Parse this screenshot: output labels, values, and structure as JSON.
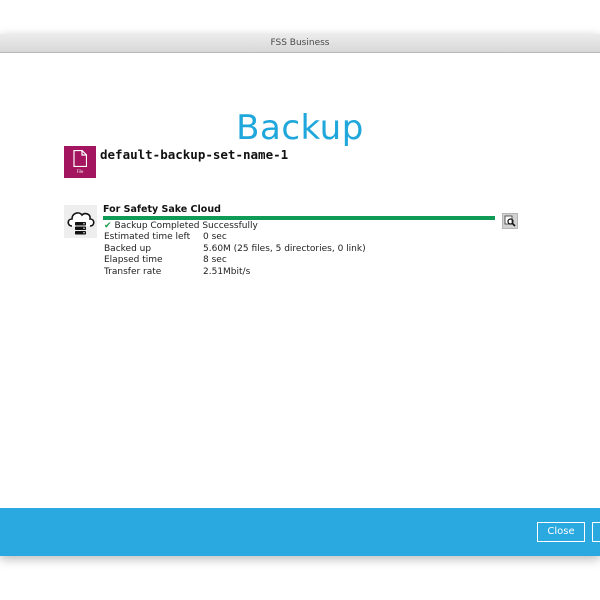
{
  "window": {
    "title": "FSS Business"
  },
  "page": {
    "heading": "Backup"
  },
  "backup_set": {
    "name": "default-backup-set-name-1",
    "icon": "file-icon",
    "icon_tag": "File",
    "icon_color": "#a3155f"
  },
  "destination": {
    "name": "For Safety Sake Cloud",
    "icon": "cloud-storage-icon",
    "progress_percent": 100,
    "progress_color": "#0f9a55",
    "status": "Backup Completed Successfully",
    "details": [
      {
        "label": "Estimated time left",
        "value": "0 sec"
      },
      {
        "label": "Backed up",
        "value": "5.60M (25 files, 5 directories, 0 link)"
      },
      {
        "label": "Elapsed time",
        "value": "8 sec"
      },
      {
        "label": "Transfer rate",
        "value": "2.51Mbit/s"
      }
    ]
  },
  "footer": {
    "close_label": "Close",
    "background": "#29a9e0"
  }
}
